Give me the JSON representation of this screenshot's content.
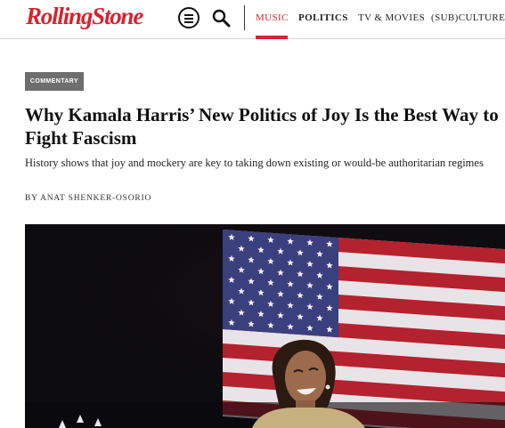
{
  "site": {
    "logo_text": "RollingStone",
    "accent_color": "#d32531"
  },
  "header": {
    "menu_icon": "hamburger-menu-icon",
    "search_icon": "search-icon",
    "nav": [
      {
        "label": "MUSIC",
        "active": true
      },
      {
        "label": "POLITICS",
        "active": false
      },
      {
        "label": "TV & MOVIES",
        "active": false
      },
      {
        "label": "(SUB)CULTURE",
        "active": false
      }
    ]
  },
  "article": {
    "category": "COMMENTARY",
    "headline": "Why Kamala Harris’ New Politics of Joy Is the Best Way to Fight Fascism",
    "subhead": "History shows that joy and mockery are key to taking down existing or would-be authoritarian regimes",
    "byline_prefix": "BY",
    "author": "ANAT SHENKER-OSORIO"
  }
}
